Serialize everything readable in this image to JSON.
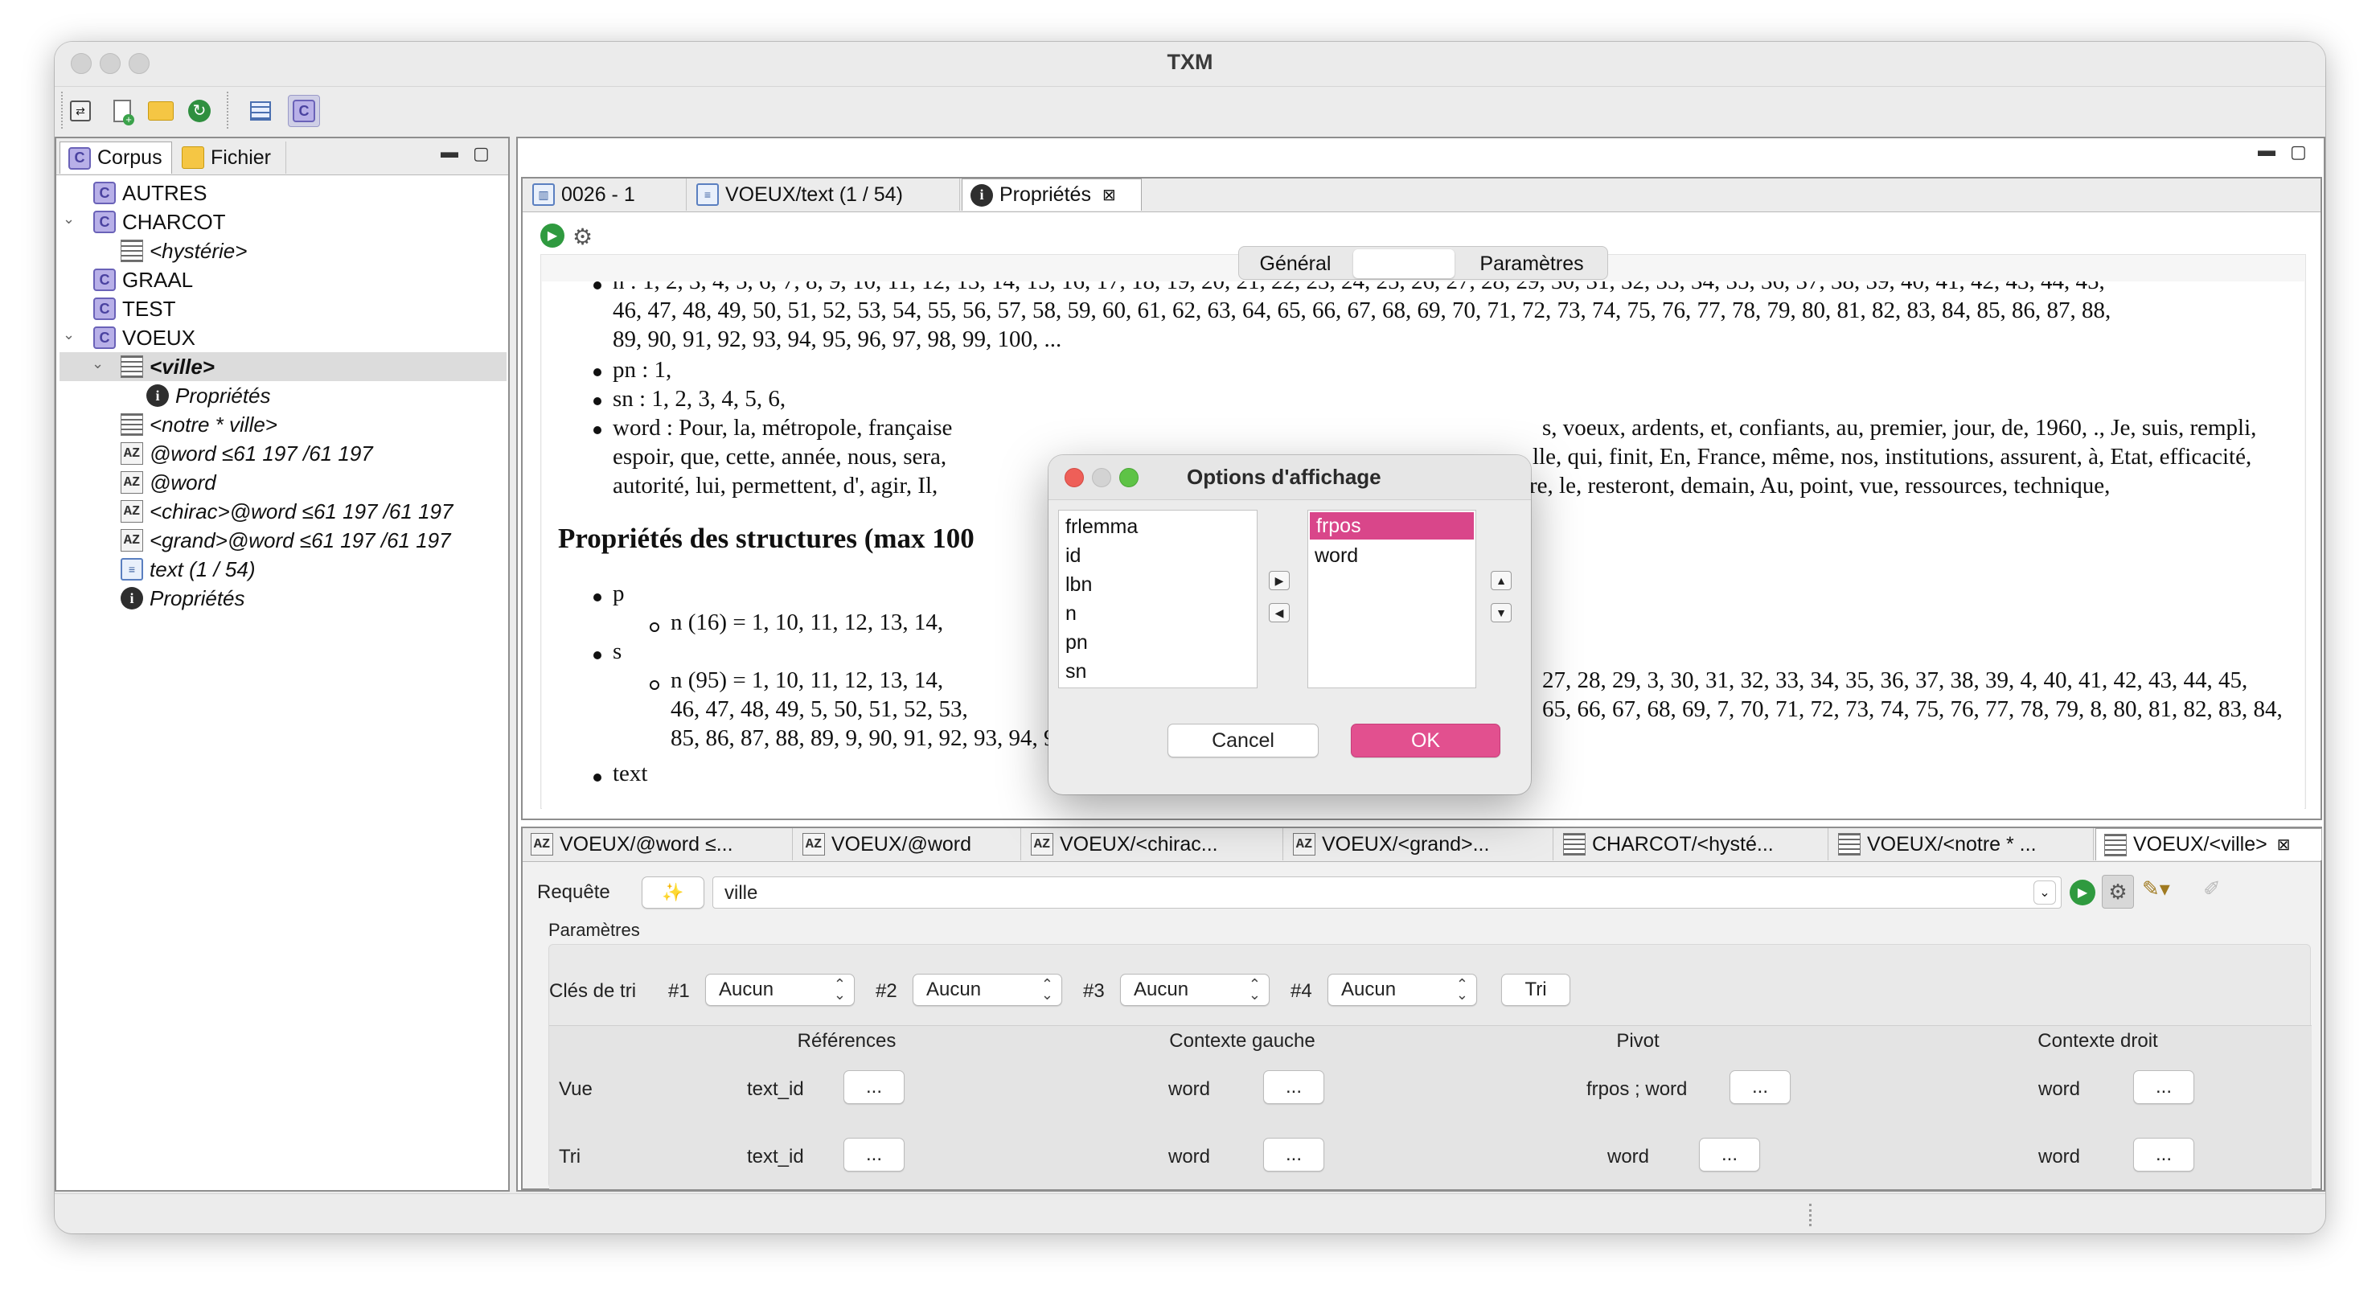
{
  "window": {
    "title": "TXM"
  },
  "toolbar": {
    "icons": [
      "corpus-switch-icon",
      "new-icon",
      "open-folder-icon",
      "refresh-icon",
      "table-icon",
      "corpus-icon"
    ]
  },
  "left_panel": {
    "tabs": [
      {
        "label": "Corpus"
      },
      {
        "label": "Fichier"
      }
    ],
    "tree": [
      {
        "label": "AUTRES",
        "icon": "corpus"
      },
      {
        "label": "CHARCOT",
        "icon": "corpus"
      },
      {
        "label": "<hystérie>",
        "icon": "partition"
      },
      {
        "label": "GRAAL",
        "icon": "corpus"
      },
      {
        "label": "TEST",
        "icon": "corpus"
      },
      {
        "label": "VOEUX",
        "icon": "corpus"
      },
      {
        "label": "<ville>",
        "icon": "partition"
      },
      {
        "label": "Propriétés",
        "icon": "info"
      },
      {
        "label": "<notre * ville>",
        "icon": "partition"
      },
      {
        "label": "@word ≤61 197 /61 197",
        "icon": "lexicon"
      },
      {
        "label": "@word",
        "icon": "lexicon"
      },
      {
        "label": "<chirac>@word ≤61 197 /61 197",
        "icon": "lexicon"
      },
      {
        "label": "<grand>@word ≤61 197 /61 197",
        "icon": "lexicon"
      },
      {
        "label": "text (1 / 54)",
        "icon": "document"
      },
      {
        "label": "Propriétés",
        "icon": "info"
      }
    ]
  },
  "editor": {
    "tabs": [
      {
        "label": "0026 - 1"
      },
      {
        "label": "VOEUX/text (1 / 54)"
      },
      {
        "label": "Propriétés"
      }
    ],
    "segments": {
      "general": "Général",
      "parametres": "Paramètres"
    },
    "content": {
      "n_line1": "n : 1, 2, 3, 4, 5, 6, 7, 8, 9, 10, 11, 12, 13, 14, 15, 16, 17, 18, 19, 20, 21, 22, 23, 24, 25, 26, 27, 28, 29, 30, 31, 32, 33, 34, 35, 36, 37, 38, 39, 40, 41, 42, 43, 44, 45,",
      "n_line2": "46, 47, 48, 49, 50, 51, 52, 53, 54, 55, 56, 57, 58, 59, 60, 61, 62, 63, 64, 65, 66, 67, 68, 69, 70, 71, 72, 73, 74, 75, 76, 77, 78, 79, 80, 81, 82, 83, 84, 85, 86, 87, 88,",
      "n_line3": "89, 90, 91, 92, 93, 94, 95, 96, 97, 98, 99, 100, ...",
      "pn_line": "pn : 1,",
      "sn_line": "sn : 1, 2, 3, 4, 5, 6,",
      "word_line1_left": "word : Pour, la, métropole, française",
      "word_line1_right": "s, voeux, ardents, et, confiants, au, premier, jour, de, 1960, ., Je, suis, rempli,",
      "word_line2_left": "espoir, que, cette, année, nous, sera,",
      "word_line2_right": "lle, qui, finit, En, France, même, nos, institutions, assurent, à, Etat, efficacité,",
      "word_line3_left": "autorité, lui, permettent, d', agir, Il,",
      "word_line3_right": "re, le, resteront, demain, Au, point, vue, ressources, technique,",
      "structures_heading": "Propriétés des structures (max 100",
      "p_label": "p",
      "p_n_line": "n (16) = 1, 10, 11, 12, 13, 14,",
      "s_label": "s",
      "s_n_line1_left": "n (95) = 1, 10, 11, 12, 13, 14,",
      "s_n_line1_right": "27, 28, 29, 3, 30, 31, 32, 33, 34, 35, 36, 37, 38, 39, 4, 40, 41, 42, 43, 44, 45,",
      "s_n_line2_left": "46, 47, 48, 49, 5, 50, 51, 52, 53,",
      "s_n_line2_right": "65, 66, 67, 68, 69, 7, 70, 71, 72, 73, 74, 75, 76, 77, 78, 79, 8, 80, 81, 82, 83, 84,",
      "s_n_line3": "85, 86, 87, 88, 89, 9, 90, 91, 92, 93, 94, 95.",
      "text_label": "text"
    }
  },
  "dialog": {
    "title": "Options d'affichage",
    "available": [
      "frlemma",
      "id",
      "lbn",
      "n",
      "pn",
      "sn"
    ],
    "selected": [
      "frpos",
      "word"
    ],
    "cancel": "Cancel",
    "ok": "OK",
    "accent": "#d9468a"
  },
  "bottom_panel": {
    "tabs": [
      {
        "label": "VOEUX/@word ≤..."
      },
      {
        "label": "VOEUX/@word"
      },
      {
        "label": "VOEUX/<chirac..."
      },
      {
        "label": "VOEUX/<grand>..."
      },
      {
        "label": "CHARCOT/<hysté..."
      },
      {
        "label": "VOEUX/<notre * ..."
      },
      {
        "label": "VOEUX/<ville>"
      }
    ],
    "query_label": "Requête",
    "query_value": "ville",
    "parametres_label": "Paramètres",
    "sort_keys_label": "Clés de tri",
    "sort_keys": [
      {
        "num": "#1",
        "value": "Aucun"
      },
      {
        "num": "#2",
        "value": "Aucun"
      },
      {
        "num": "#3",
        "value": "Aucun"
      },
      {
        "num": "#4",
        "value": "Aucun"
      }
    ],
    "sort_button": "Tri",
    "columns": [
      "Références",
      "Contexte gauche",
      "Pivot",
      "Contexte droit"
    ],
    "rows": [
      {
        "label": "Vue",
        "values": [
          "text_id",
          "word",
          "frpos ; word",
          "word"
        ]
      },
      {
        "label": "Tri",
        "values": [
          "text_id",
          "word",
          "word",
          "word"
        ]
      }
    ],
    "ellipsis": "..."
  }
}
